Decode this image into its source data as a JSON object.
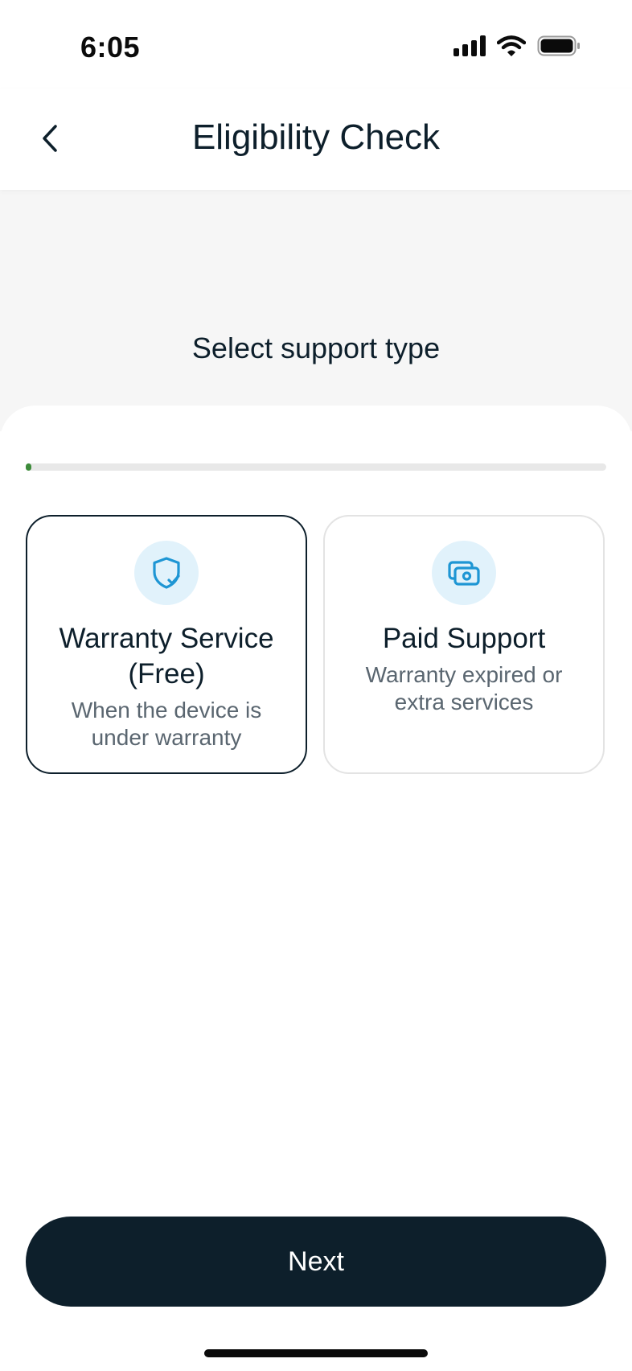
{
  "status": {
    "time": "6:05"
  },
  "nav": {
    "title": "Eligibility Check"
  },
  "hero": {
    "title": "Select support type"
  },
  "progress": {
    "value": 0.01
  },
  "options": [
    {
      "title": "Warranty Service (Free)",
      "description": "When the device is under warranty",
      "selected": true,
      "icon": "shield-check-icon"
    },
    {
      "title": "Paid Support",
      "description": "Warranty expired or extra services",
      "selected": false,
      "icon": "money-icon"
    }
  ],
  "actions": {
    "next_label": "Next"
  },
  "colors": {
    "primary": "#0d1f2b",
    "accent": "#1e96d4",
    "progress": "#3d8b3a",
    "icon_bg": "#e1f2fb"
  }
}
